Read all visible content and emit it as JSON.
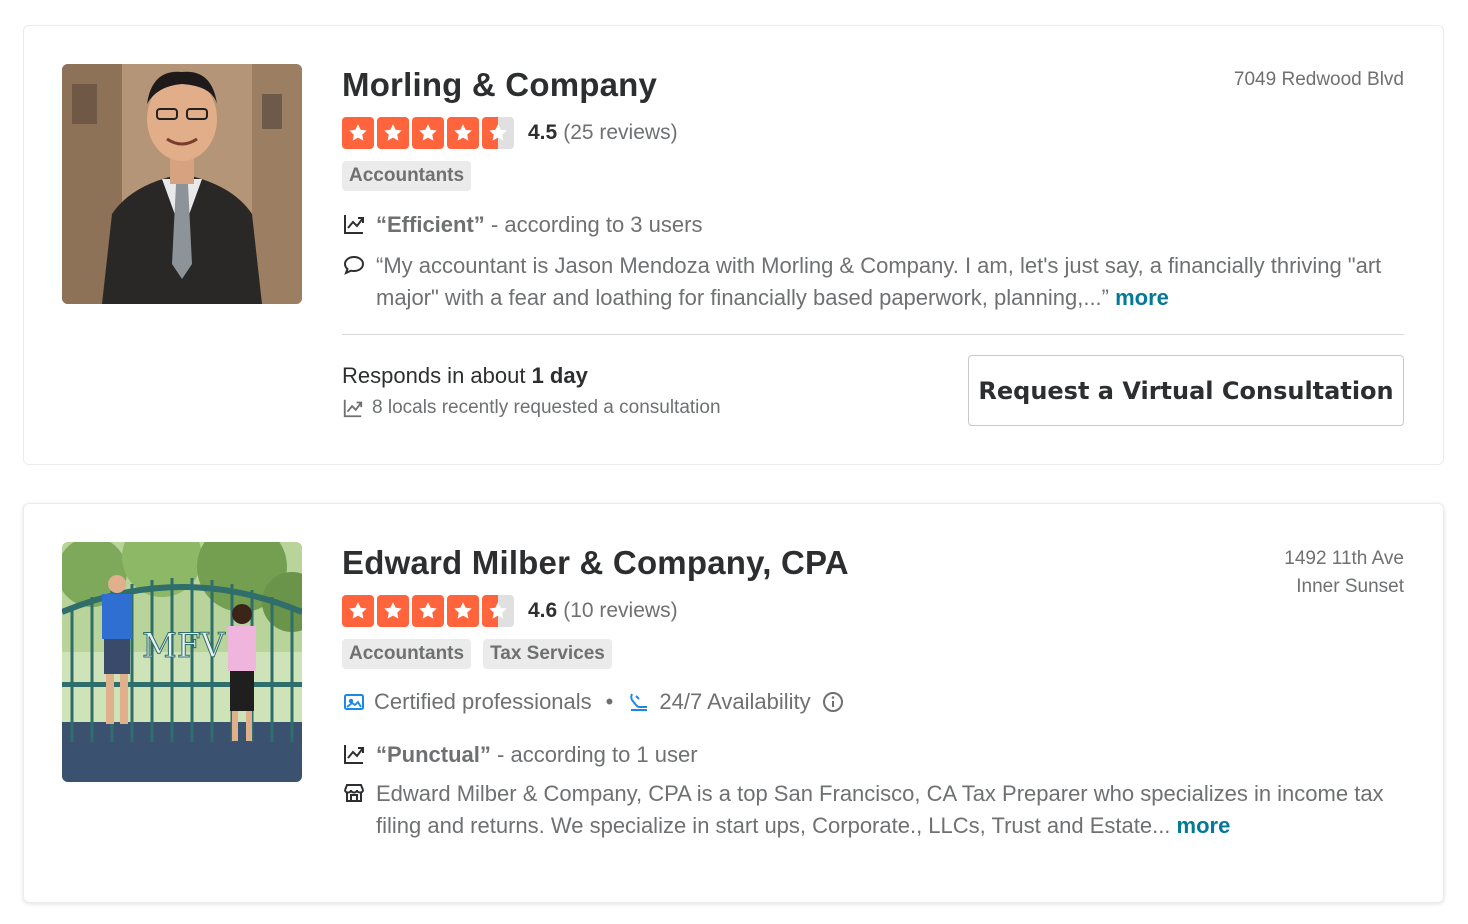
{
  "results": [
    {
      "name": "Morling & Company",
      "address_lines": [
        "7049 Redwood Blvd"
      ],
      "rating": "4.5",
      "review_count": "(25 reviews)",
      "tags": [
        "Accountants"
      ],
      "highlight": {
        "quote": "“Efficient”",
        "suffix": " - according to 3 users"
      },
      "snippet": "“My accountant is Jason Mendoza with Morling & Company. I am, let's just say, a financially thriving \"art major\" with a fear and loathing for financially based paperwork, planning,...”",
      "more_label": "more",
      "responds_prefix": "Responds in about ",
      "responds_time": "1 day",
      "locals_text": "8 locals recently requested a consultation",
      "cta_label": "Request a Virtual Consultation",
      "icons": [
        "trending-icon",
        "speech-bubble-icon"
      ]
    },
    {
      "name": "Edward Milber & Company, CPA",
      "address_lines": [
        "1492 11th Ave",
        "Inner Sunset"
      ],
      "rating": "4.6",
      "review_count": "(10 reviews)",
      "tags": [
        "Accountants",
        "Tax Services"
      ],
      "features": [
        "Certified professionals",
        "•",
        "24/7 Availability"
      ],
      "highlight": {
        "quote": "“Punctual”",
        "suffix": " - according to 1 user"
      },
      "snippet": "Edward Milber & Company, CPA is a top San Francisco, CA Tax Preparer who specializes in income tax filing and returns. We specialize in start ups, Corporate., LLCs, Trust and Estate...",
      "more_label": "more",
      "icons": [
        "certificate-icon",
        "support-icon",
        "info-icon",
        "trending-icon",
        "storefront-icon"
      ]
    }
  ],
  "colors": {
    "star": "#ff643d",
    "link": "#027a97",
    "feature_icon": "#1e88e5"
  }
}
